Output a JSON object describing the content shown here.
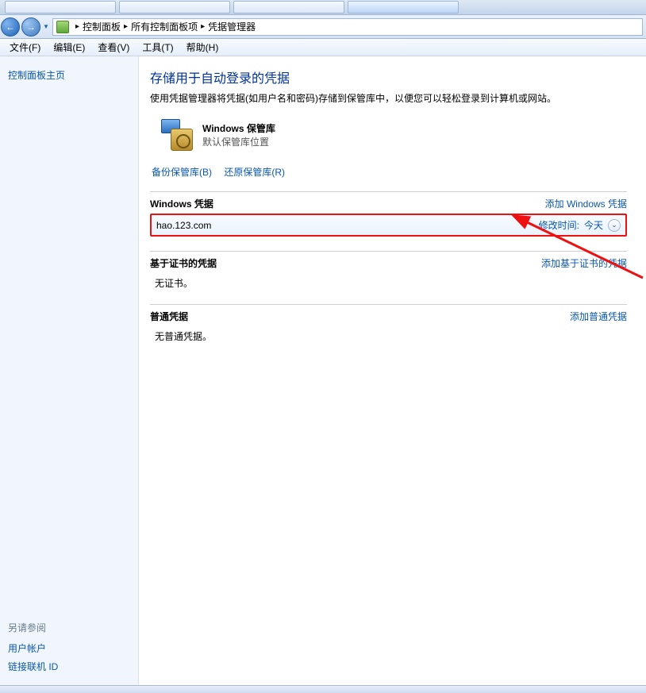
{
  "taskbar": {
    "tabs": [
      {
        "label": ""
      },
      {
        "label": ""
      },
      {
        "label": ""
      },
      {
        "label": ""
      }
    ]
  },
  "nav": {
    "back_glyph": "←",
    "forward_glyph": "→",
    "dropdown_glyph": "▼"
  },
  "breadcrumb": {
    "items": [
      "控制面板",
      "所有控制面板项",
      "凭据管理器"
    ],
    "sep": "▸"
  },
  "menu": {
    "file": "文件(F)",
    "edit": "编辑(E)",
    "view": "查看(V)",
    "tools": "工具(T)",
    "help": "帮助(H)"
  },
  "sidebar": {
    "home_link": "控制面板主页",
    "see_also_heading": "另请参阅",
    "see_also_items": [
      "用户帐户",
      "链接联机 ID"
    ]
  },
  "page": {
    "title": "存储用于自动登录的凭据",
    "desc": "使用凭据管理器将凭据(如用户名和密码)存储到保管库中，以便您可以轻松登录到计算机或网站。"
  },
  "vault": {
    "title": "Windows 保管库",
    "subtitle": "默认保管库位置"
  },
  "vault_links": {
    "backup": "备份保管库(B)",
    "restore": "还原保管库(R)"
  },
  "sections": {
    "windows": {
      "title": "Windows 凭据",
      "add": "添加 Windows 凭据",
      "entry": {
        "name": "hao.123.com",
        "meta_label": "修改时间:",
        "meta_value": "今天",
        "expand_glyph": "⌄"
      }
    },
    "cert": {
      "title": "基于证书的凭据",
      "add": "添加基于证书的凭据",
      "empty": "无证书。"
    },
    "generic": {
      "title": "普通凭据",
      "add": "添加普通凭据",
      "empty": "无普通凭据。"
    }
  }
}
